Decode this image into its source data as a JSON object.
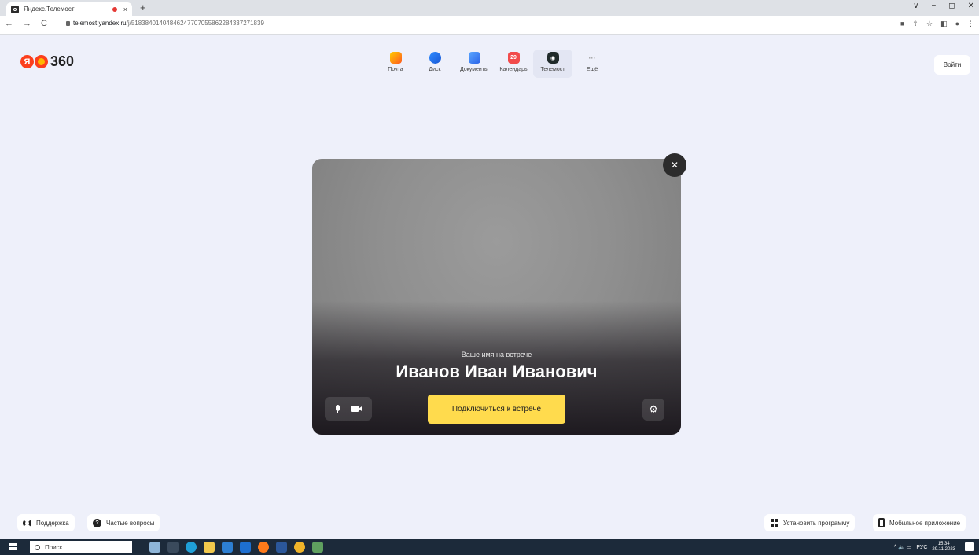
{
  "browser": {
    "tab_title": "Яндекс.Телемост",
    "tab_close": "×",
    "new_tab": "+",
    "nav": {
      "back": "←",
      "forward": "→",
      "reload": "C"
    },
    "url_host": "telemost.yandex.ru",
    "url_path": "/j/51838401404846247707055862284337271839",
    "window": {
      "dropdown": "∨",
      "minimize": "−",
      "restore": "◻",
      "close": "✕"
    },
    "toolbar_icons": [
      "■",
      "⇪",
      "☆",
      "◧",
      "●",
      "⋮"
    ]
  },
  "header": {
    "logo_letter": "Я",
    "logo_number": "360",
    "login_label": "Войти",
    "services": [
      {
        "label": "Почта",
        "icon": "mail-icon",
        "glyph": ""
      },
      {
        "label": "Диск",
        "icon": "disk-icon",
        "glyph": ""
      },
      {
        "label": "Документы",
        "icon": "documents-icon",
        "glyph": ""
      },
      {
        "label": "Календарь",
        "icon": "calendar-icon",
        "glyph": "29"
      },
      {
        "label": "Телемост",
        "icon": "telemost-icon",
        "glyph": "◉"
      },
      {
        "label": "Ещё",
        "icon": "more-icon",
        "glyph": "···"
      }
    ]
  },
  "card": {
    "name_hint": "Ваше имя на встрече",
    "name": "Иванов Иван Иванович",
    "join_label": "Подключиться к встрече",
    "close_glyph": "✕",
    "settings_glyph": "⚙"
  },
  "footer": {
    "support_label": "Поддержка",
    "faq_label": "Частые вопросы",
    "faq_glyph": "?",
    "install_label": "Установить программу",
    "mobile_label": "Мобильное приложение"
  },
  "taskbar": {
    "search_placeholder": "Поиск",
    "language": "РУС",
    "time": "15:34",
    "date": "29.11.2023",
    "tray_icons": "^ 🔈 ▭"
  },
  "colors": {
    "page_bg": "#eef0fa",
    "join_button": "#ffdb4d",
    "brand_red": "#fc3f1d",
    "taskbar": "#1c2a3a"
  }
}
